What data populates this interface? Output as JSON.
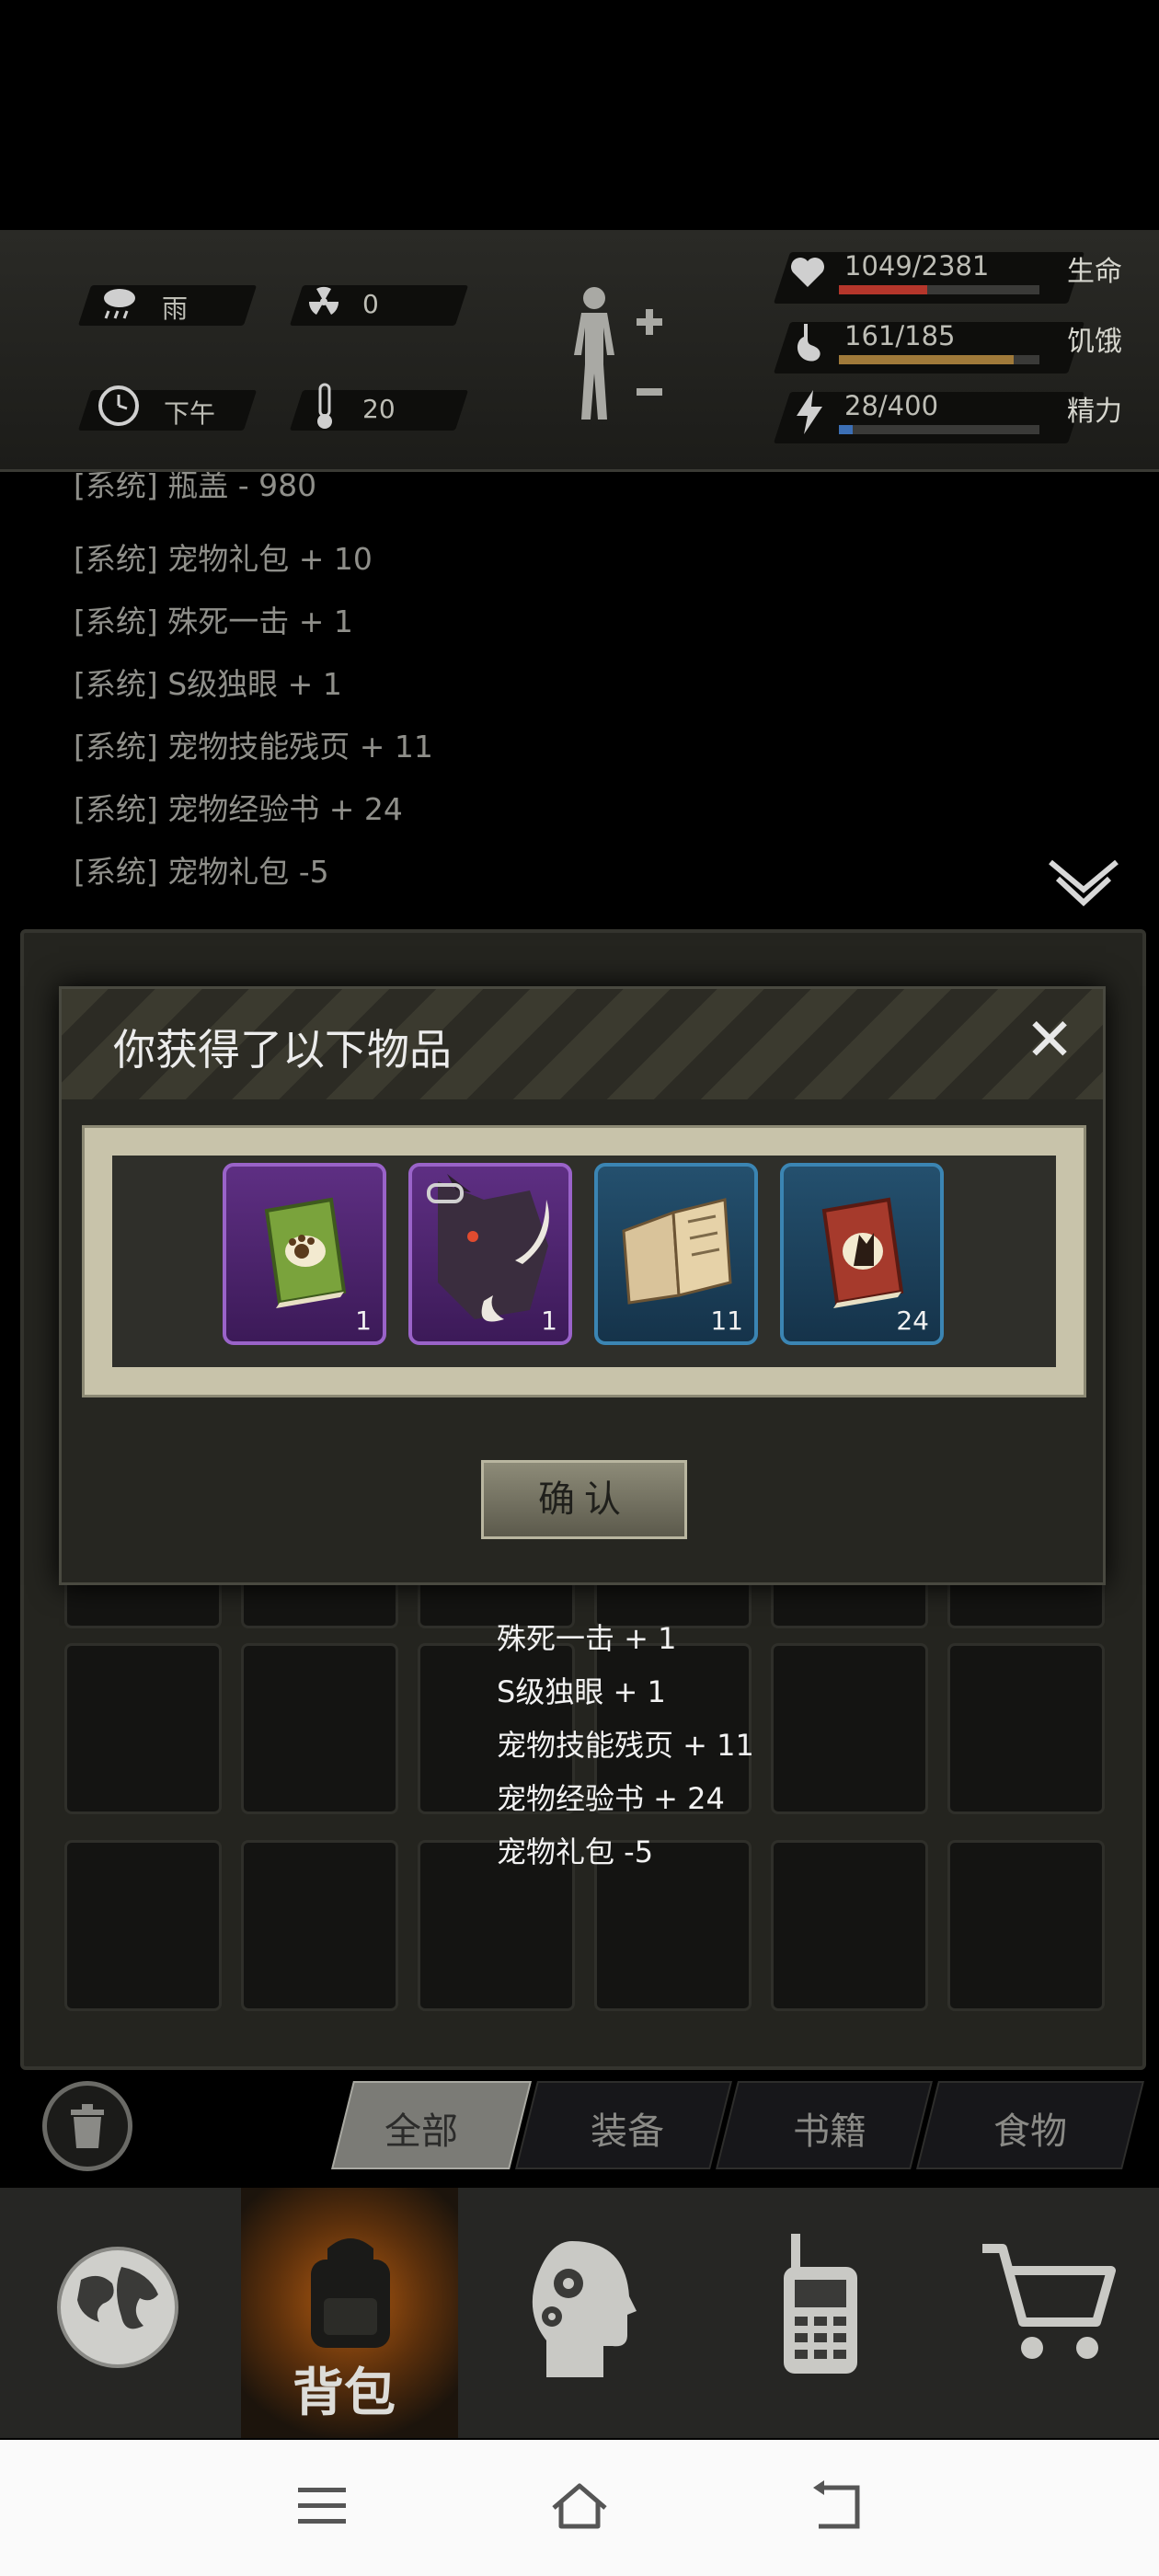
{
  "status": {
    "weather": "雨",
    "radiation": "0",
    "time_of_day": "下午",
    "temperature": "20",
    "health": {
      "text": "1049/2381",
      "label": "生命",
      "fraction": 0.44,
      "color": "#b5362b"
    },
    "hunger": {
      "text": "161/185",
      "label": "饥饿",
      "fraction": 0.87,
      "color": "#a07a3a"
    },
    "energy": {
      "text": "28/400",
      "label": "精力",
      "fraction": 0.07,
      "color": "#3c6fb5"
    }
  },
  "log": {
    "lines": [
      "[系统] 瓶盖 - 980",
      "[系统] 宠物礼包 + 10",
      "[系统] 殊死一击 + 1",
      "[系统] S级独眼 + 1",
      "[系统] 宠物技能残页 + 11",
      "[系统] 宠物经验书 + 24",
      "[系统] 宠物礼包 -5"
    ]
  },
  "modal": {
    "title": "你获得了以下物品",
    "close_label": "✕",
    "confirm_label": "确认",
    "items": [
      {
        "icon": "paw-book-icon",
        "count": "1",
        "rarity": "purple"
      },
      {
        "icon": "boar-head-icon",
        "count": "1",
        "rarity": "purple"
      },
      {
        "icon": "torn-pages-icon",
        "count": "11",
        "rarity": "blue"
      },
      {
        "icon": "red-paw-book-icon",
        "count": "24",
        "rarity": "blue"
      }
    ]
  },
  "toasts": [
    "殊死一击 + 1",
    "S级独眼 + 1",
    "宠物技能残页 + 11",
    "宠物经验书 + 24",
    "宠物礼包 -5"
  ],
  "tabs": [
    "全部",
    "装备",
    "书籍",
    "食物"
  ],
  "nav": {
    "backpack_label": "背包",
    "items": [
      "globe-icon",
      "backpack-icon",
      "head-gears-icon",
      "radio-icon",
      "cart-icon"
    ]
  }
}
